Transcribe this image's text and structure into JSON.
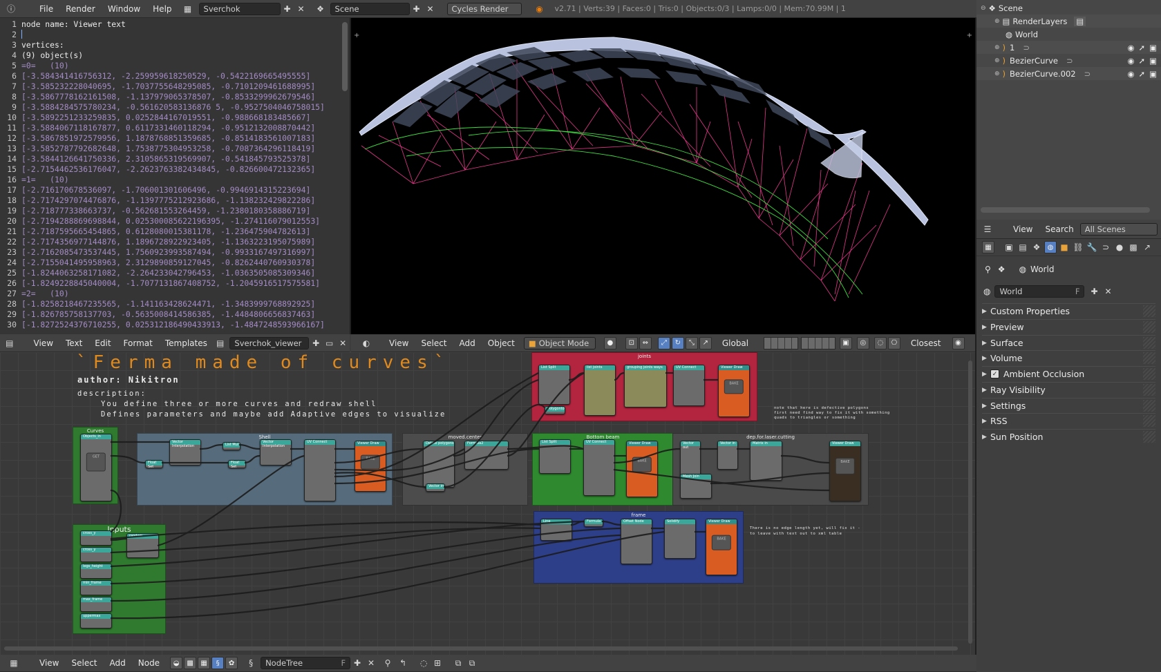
{
  "topbar": {
    "menus": [
      "File",
      "Render",
      "Window",
      "Help"
    ],
    "screen_layout": "Sverchok",
    "scene": "Scene",
    "render_engine": "Cycles Render",
    "stats": "v2.71 | Verts:39 | Faces:0 | Tris:0 | Objects:0/3 | Lamps:0/0 | Mem:70.99M | 1"
  },
  "text_editor": {
    "lines": [
      {
        "n": "1",
        "t": "node name: Viewer text",
        "v": false
      },
      {
        "n": "2",
        "t": "",
        "v": false
      },
      {
        "n": "3",
        "t": "vertices:",
        "v": false
      },
      {
        "n": "4",
        "t": "(9) object(s)",
        "v": false
      },
      {
        "n": "5",
        "t": "=0=   (10)",
        "v": true
      },
      {
        "n": "6",
        "t": "[-3.584341416756312, -2.259959618250529, -0.5422169665495555]",
        "v": true
      },
      {
        "n": "7",
        "t": "[-3.585232228040695, -1.7037755648295085, -0.7101209461688995]",
        "v": true
      },
      {
        "n": "8",
        "t": "[-3.5867778162161508, -1.137979065378507, -0.8533299962679546]",
        "v": true
      },
      {
        "n": "9",
        "t": "[-3.5884284575780234, -0.561620583136876 5, -0.9527504046758015]",
        "v": true
      },
      {
        "n": "10",
        "t": "[-3.5892251233259835, 0.0252844167019551, -0.988668183485667]",
        "v": true
      },
      {
        "n": "11",
        "t": "[-3.5884067118167877, 0.6117331460118294, -0.9512132008870442]",
        "v": true
      },
      {
        "n": "12",
        "t": "[-3.5867851972579956, 1.1878768851359685, -0.8514183561007183]",
        "v": true
      },
      {
        "n": "13",
        "t": "[-3.5852787792682648, 1.7538775304953258, -0.7087364296118419]",
        "v": true
      },
      {
        "n": "14",
        "t": "[-3.5844126641750336, 2.3105865319569907, -0.541845793525378]",
        "v": true
      },
      {
        "n": "15",
        "t": "[-2.7154462536176047, -2.2623763382434845, -0.826600472132365]",
        "v": true
      },
      {
        "n": "16",
        "t": "=1=   (10)",
        "v": true
      },
      {
        "n": "17",
        "t": "[-2.716170678536097, -1.706001301606496, -0.9946914315223694]",
        "v": true
      },
      {
        "n": "18",
        "t": "[-2.7174297074476876, -1.1397775212923686, -1.138232429822286]",
        "v": true
      },
      {
        "n": "19",
        "t": "[-2.718777338663737, -0.562681553264459, -1.2380180358886719]",
        "v": true
      },
      {
        "n": "20",
        "t": "[-2.7194288869698844, 0.025300085622196395, -1.274116079012553]",
        "v": true
      },
      {
        "n": "21",
        "t": "[-2.7187595665454865, 0.6128080015381178, -1.236475904782613]",
        "v": true
      },
      {
        "n": "22",
        "t": "[-2.7174356977144876, 1.1896728922923405, -1.1363223195075989]",
        "v": true
      },
      {
        "n": "23",
        "t": "[-2.7162085473537445, 1.7560923993587494, -0.9933167497316997]",
        "v": true
      },
      {
        "n": "24",
        "t": "[-2.7155041495958963, 2.3129890859127045, -0.8262440760930378]",
        "v": true
      },
      {
        "n": "25",
        "t": "[-1.8244063258171082, -2.264233042796453, -1.0363505085309346]",
        "v": true
      },
      {
        "n": "26",
        "t": "[-1.8249228845040004, -1.7077131867408752, -1.2045916517575581]",
        "v": true
      },
      {
        "n": "27",
        "t": "=2=   (10)",
        "v": true
      },
      {
        "n": "28",
        "t": "[-1.8258218467235565, -1.141163428624471, -1.3483999768892925]",
        "v": true
      },
      {
        "n": "29",
        "t": "[-1.826785758137703, -0.5635008414586385, -1.4484806656837463]",
        "v": true
      },
      {
        "n": "30",
        "t": "[-1.8272524376710255, 0.025312186490433913, -1.4847248593966167]",
        "v": true
      }
    ]
  },
  "text_header": {
    "menus": [
      "View",
      "Text",
      "Edit",
      "Format",
      "Templates"
    ],
    "datablock": "Sverchok_viewer"
  },
  "view3d_header": {
    "menus": [
      "View",
      "Select",
      "Add",
      "Object"
    ],
    "mode": "Object Mode",
    "orientation": "Global",
    "snap": "Closest"
  },
  "node_editor": {
    "title": "`Ferma made of curves`",
    "author": "author: Nikitron",
    "desc_label": "description:",
    "desc_line1": "You define three or more curves and redraw shell",
    "desc_line2": "Defines parameters and maybe add Adaptive edges to visualize",
    "note1": "note that here is defective polygons\nfirst need find way to fix it with something\nquads to triangles or something",
    "note2": "There is no edge length yet, will fix it -\nto leave with text out to xml table",
    "frames": [
      "Curves",
      "Inputs",
      "Shell",
      "moved.center",
      "joints",
      "Bottom beam",
      "dep.for.laser.cutting",
      "frame"
    ]
  },
  "node_header": {
    "menus": [
      "View",
      "Select",
      "Add",
      "Node"
    ],
    "tree": "NodeTree"
  },
  "outliner": {
    "items": [
      "Scene",
      "RenderLayers",
      "World",
      "1",
      "BezierCurve",
      "BezierCurve.002"
    ]
  },
  "outliner_header": {
    "menus": [
      "View",
      "Search"
    ],
    "filter": "All Scenes"
  },
  "properties": {
    "context": "World",
    "world_field": "World",
    "panels": [
      "Custom Properties",
      "Preview",
      "Surface",
      "Volume",
      "Ambient Occlusion",
      "Ray Visibility",
      "Settings",
      "RSS",
      "Sun Position"
    ]
  }
}
